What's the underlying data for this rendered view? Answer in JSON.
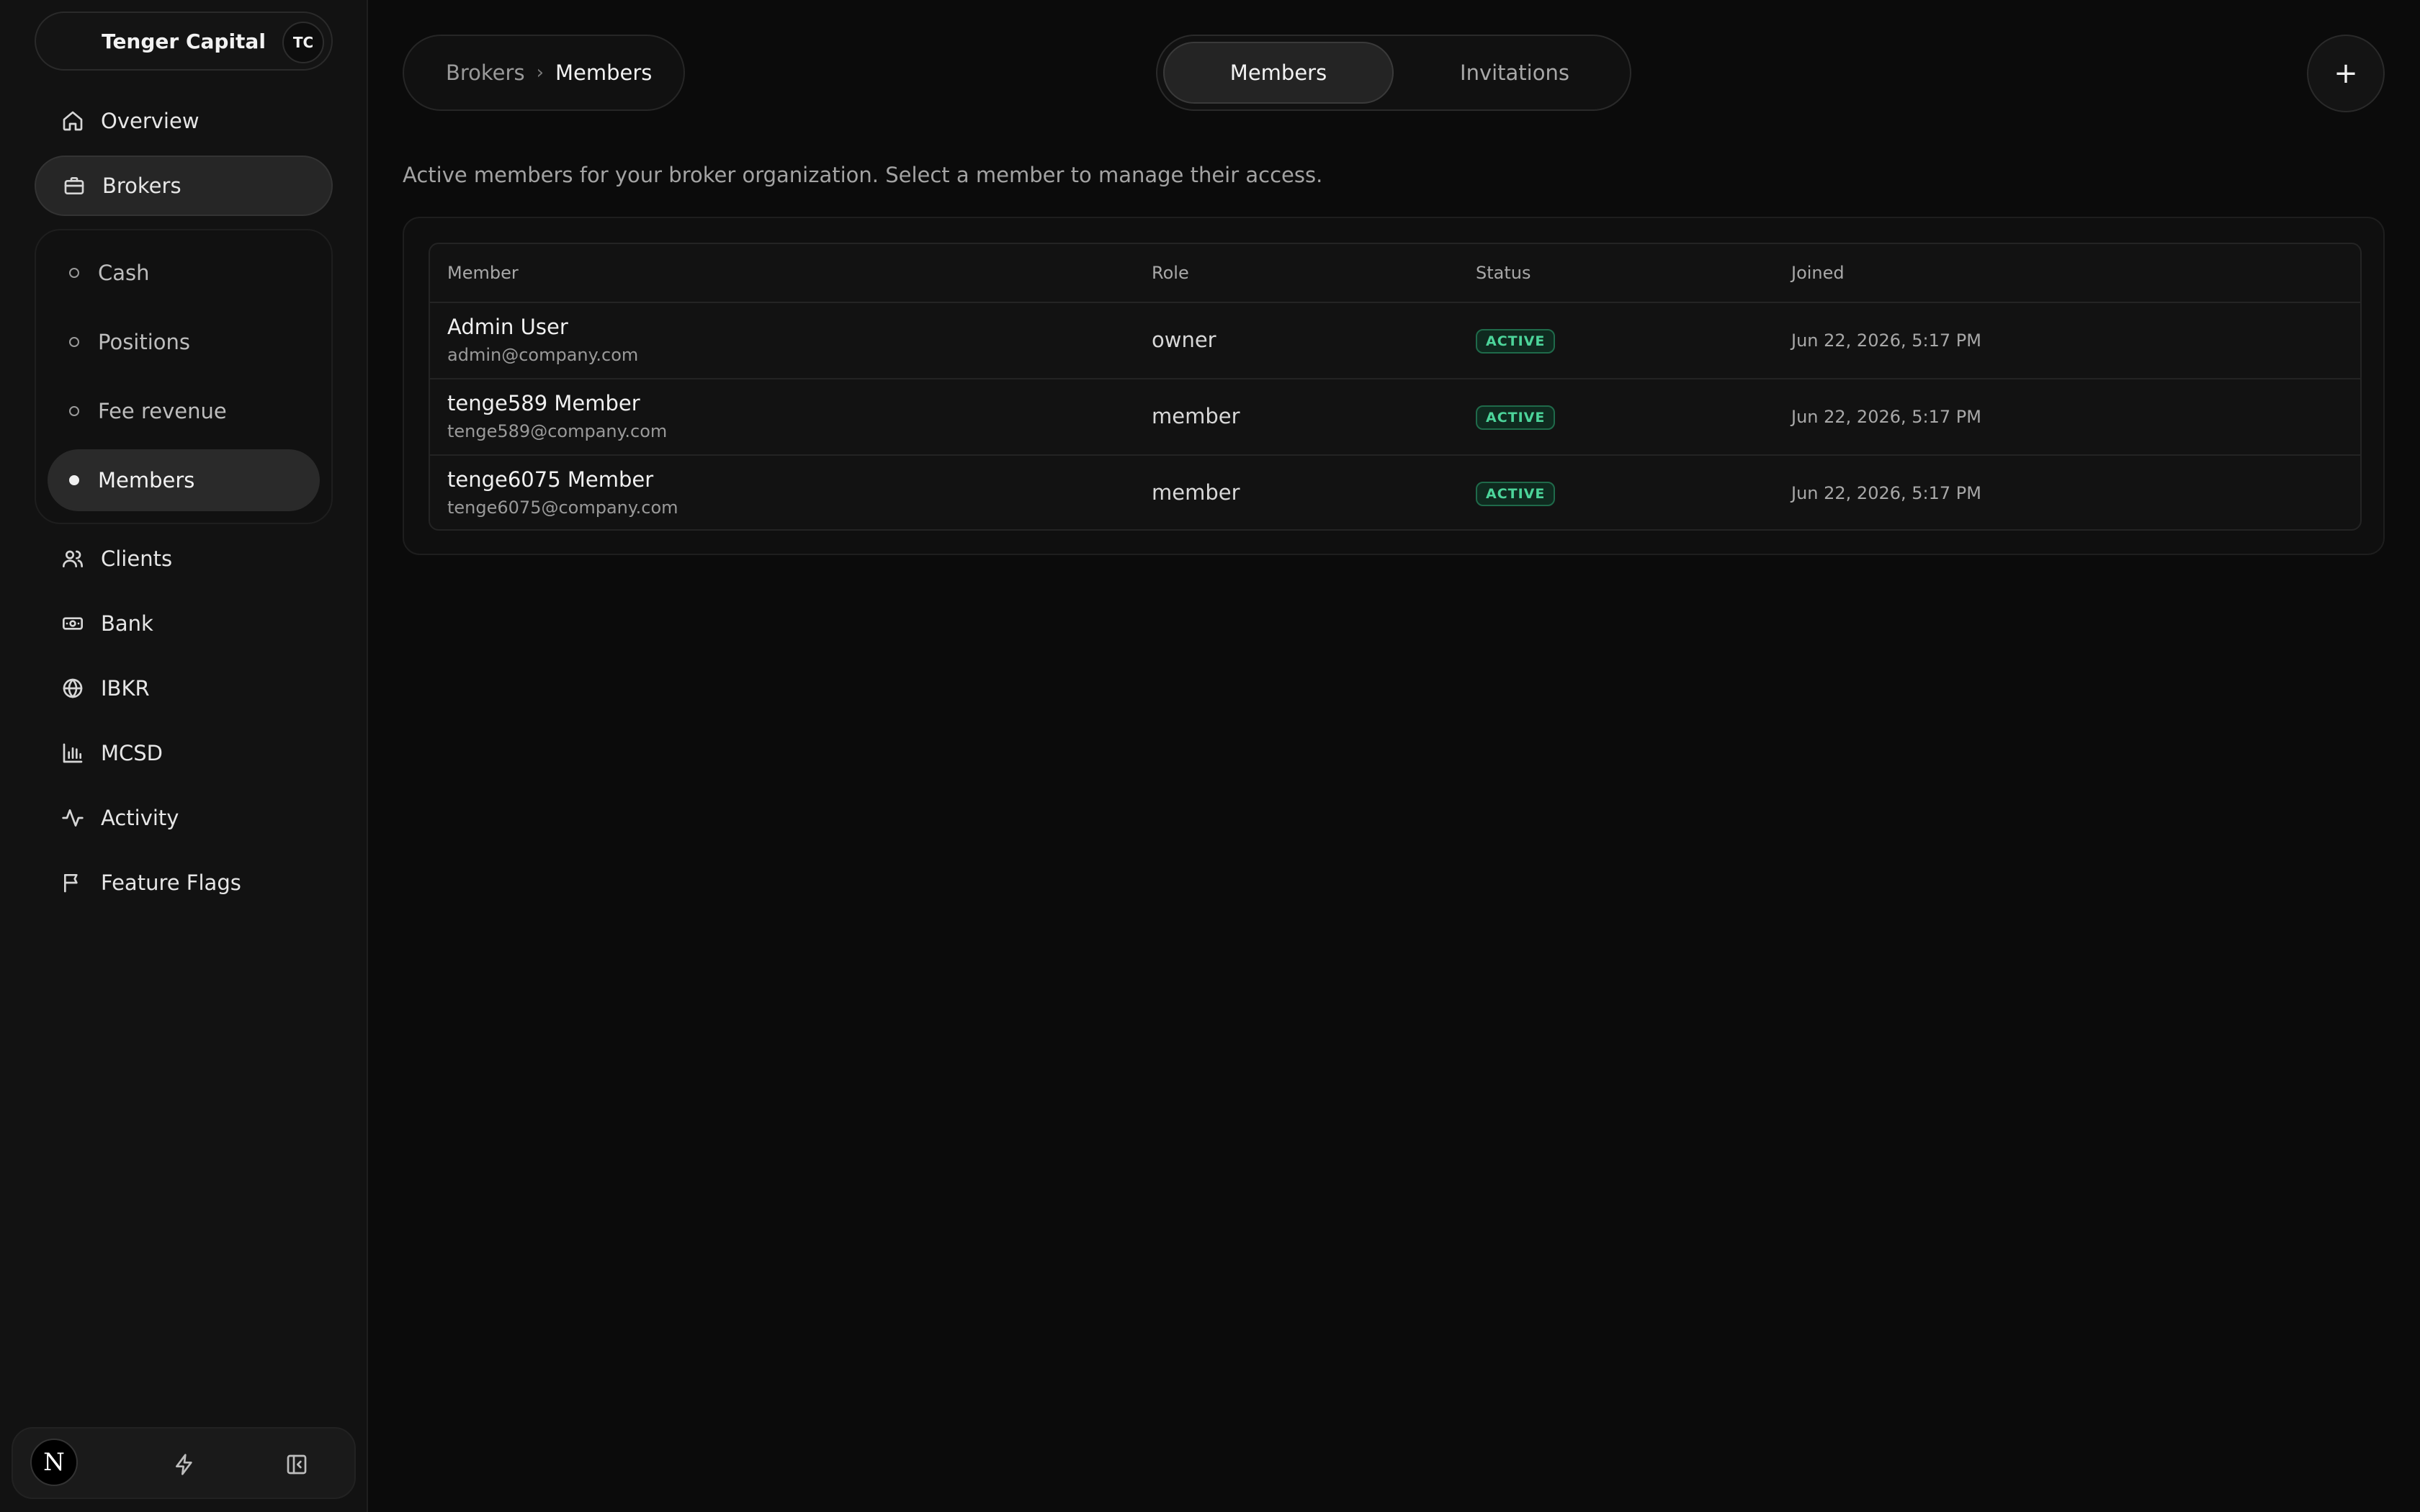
{
  "org": {
    "name": "Tenger Capital",
    "initials": "TC"
  },
  "sidebar": {
    "items": [
      {
        "label": "Overview",
        "icon": "home-icon"
      },
      {
        "label": "Brokers",
        "icon": "briefcase-icon"
      },
      {
        "label": "Clients",
        "icon": "users-icon"
      },
      {
        "label": "Bank",
        "icon": "banknote-icon"
      },
      {
        "label": "IBKR",
        "icon": "globe-icon"
      },
      {
        "label": "MCSD",
        "icon": "bar-chart-icon"
      },
      {
        "label": "Activity",
        "icon": "activity-icon"
      },
      {
        "label": "Feature Flags",
        "icon": "flag-icon"
      }
    ],
    "sub_items": [
      {
        "label": "Cash"
      },
      {
        "label": "Positions"
      },
      {
        "label": "Fee revenue"
      },
      {
        "label": "Members"
      }
    ],
    "footer": {
      "logo_letter": "N"
    }
  },
  "breadcrumb": {
    "parent": "Brokers",
    "separator": "›",
    "current": "Members"
  },
  "tabs": [
    {
      "label": "Members"
    },
    {
      "label": "Invitations"
    }
  ],
  "add_button": {
    "label": "+"
  },
  "description": "Active members for your broker organization. Select a member to manage their access.",
  "table": {
    "headers": {
      "member": "Member",
      "role": "Role",
      "status": "Status",
      "joined": "Joined"
    },
    "rows": [
      {
        "name": "Admin User",
        "email": "admin@company.com",
        "role": "owner",
        "status": "ACTIVE",
        "joined": "Jun 22, 2026, 5:17 PM"
      },
      {
        "name": "tenge589 Member",
        "email": "tenge589@company.com",
        "role": "member",
        "status": "ACTIVE",
        "joined": "Jun 22, 2026, 5:17 PM"
      },
      {
        "name": "tenge6075 Member",
        "email": "tenge6075@company.com",
        "role": "member",
        "status": "ACTIVE",
        "joined": "Jun 22, 2026, 5:17 PM"
      }
    ]
  },
  "colors": {
    "background": "#0b0b0b",
    "sidebar": "#121212",
    "status_active": "#4cd49a"
  }
}
